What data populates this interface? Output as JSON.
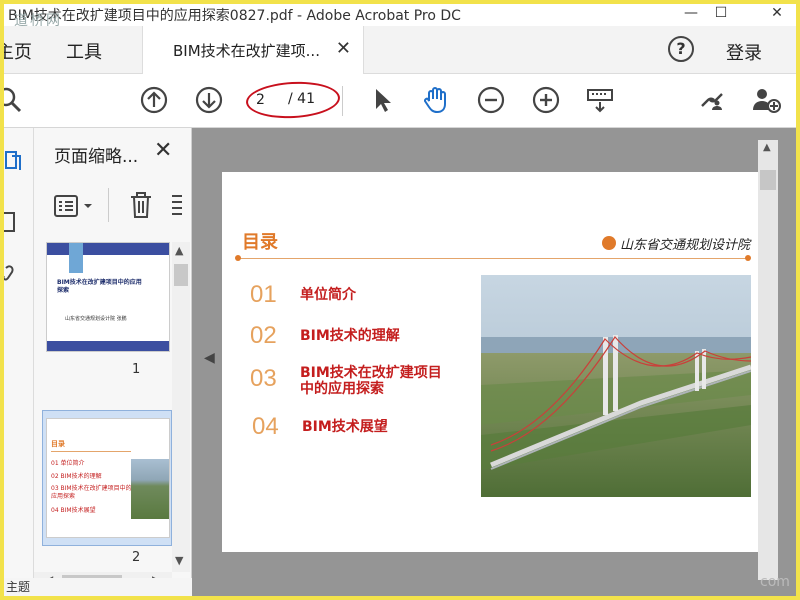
{
  "window": {
    "title": "BIM技术在改扩建项目中的应用探索0827.pdf - Adobe Acrobat Pro DC",
    "watermark": "道桥网",
    "min_label": "—",
    "max_label": "☐",
    "close_label": "✕"
  },
  "menu": {
    "home": "主页",
    "tools": "工具"
  },
  "tab": {
    "label": "BIM技术在改扩建项...",
    "close": "✕"
  },
  "header": {
    "help": "?",
    "login": "登录"
  },
  "toolbar": {
    "icons": [
      "search-icon",
      "prev-page-icon",
      "next-page-icon",
      "select-cursor-icon",
      "hand-icon",
      "zoom-out-icon",
      "zoom-in-icon",
      "keyboard-icon",
      "share-link-icon",
      "add-user-icon"
    ],
    "page_current": "2",
    "page_total": "/ 41"
  },
  "thumbs_panel": {
    "title": "页面缩略...",
    "close": "✕",
    "thumbs": [
      {
        "num": "1",
        "title": "BIM技术在改扩建项目中的应用探索",
        "footer": "山东省交通规划设计院 张鹏"
      },
      {
        "num": "2",
        "heading": "目录",
        "items": [
          "01 单位简介",
          "02 BIM技术的理解",
          "03 BIM技术在改扩建项目中的应用探索",
          "04 BIM技术展望"
        ]
      }
    ]
  },
  "slide": {
    "title": "目录",
    "org": "山东省交通规划设计院",
    "toc": [
      {
        "num": "01",
        "text": "单位简介"
      },
      {
        "num": "02",
        "text": "BIM技术的理解"
      },
      {
        "num": "03",
        "text": "BIM技术在改扩建项目\n中的应用探索"
      },
      {
        "num": "04",
        "text": "BIM技术展望"
      }
    ]
  },
  "bottom": {
    "left_text": "主题",
    "corner_watermark": "com"
  },
  "colors": {
    "accent_orange": "#e07a2a",
    "toc_red": "#c41e1e",
    "annotation_red": "#c8101d",
    "frame_yellow": "#f2e24b"
  }
}
